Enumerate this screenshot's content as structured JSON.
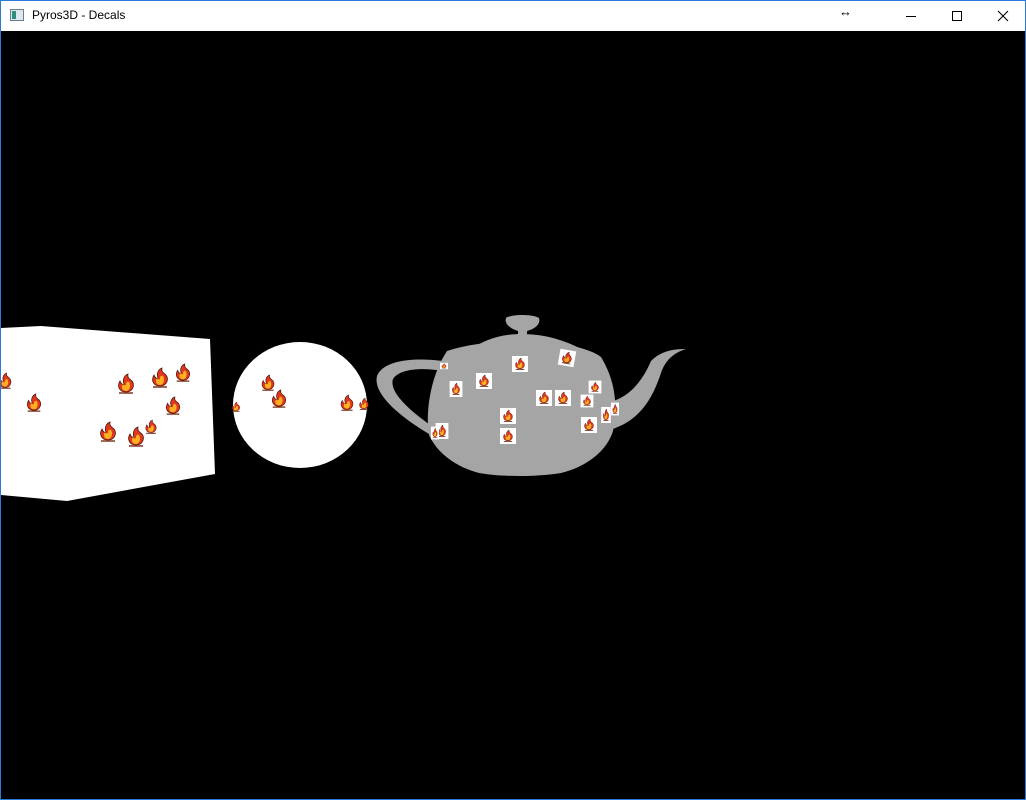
{
  "window": {
    "title": "Pyros3D - Decals",
    "controls": [
      "minimize-icon",
      "maximize-icon",
      "close-icon"
    ],
    "resize_cursor_icon": "horizontal-resize-icon"
  },
  "scene": {
    "background_color": "#000000",
    "objects": [
      {
        "name": "cube",
        "color": "#ffffff"
      },
      {
        "name": "sphere",
        "color": "#ffffff"
      },
      {
        "name": "teapot",
        "color": "#a5a5a5"
      }
    ],
    "decal_icon": "fire-icon"
  }
}
